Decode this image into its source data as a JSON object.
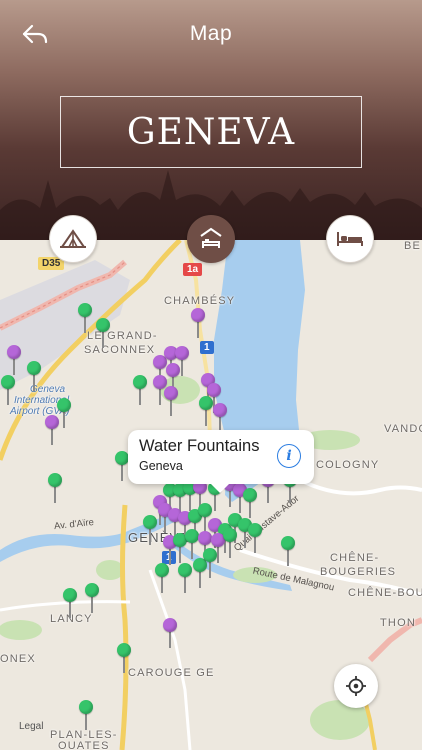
{
  "nav": {
    "title": "Map",
    "back_icon": "back-arrow-icon"
  },
  "header": {
    "city": "GENEVA"
  },
  "categories": [
    {
      "label": "attractions",
      "icon": "tent-icon",
      "active": false
    },
    {
      "label": "hotels",
      "icon": "hotel-icon",
      "active": true
    },
    {
      "label": "accommodation",
      "icon": "bed-icon",
      "active": false
    }
  ],
  "map": {
    "places": {
      "chambesy": "CHAMBÉSY",
      "grand_saconnex_1": "LE GRAND-",
      "grand_saconnex_2": "SACONNEX",
      "airport_1": "Geneva",
      "airport_2": "International",
      "airport_3": "Airport (GVA)",
      "vandoeuvres": "VANDO",
      "cologny": "COLOGNY",
      "geneva": "GENÈVE",
      "chene_bougeries_1": "CHÊNE-",
      "chene_bougeries_2": "BOUGERIES",
      "chene_bourg": "CHÊNE-BOU",
      "thonex": "THON",
      "lancy": "LANCY",
      "onex": "ONEX",
      "carouge": "CAROUGE GE",
      "plan_les_ouates_1": "PLAN-LES-",
      "plan_les_ouates_2": "OUATES",
      "bellevue": "BE"
    },
    "roads": {
      "d35": "D35",
      "r1a": "1a",
      "r1_north": "1",
      "r1_south": "1",
      "av_aire": "Av. d'Aïre",
      "malagnou": "Route de Malagnou",
      "quai": "Quai Gustave-Ador"
    },
    "pin_colors": {
      "green": "#35c46a",
      "purple": "#b566d8"
    },
    "water_color": "#a7cdee",
    "callout": {
      "title": "Water Fountains",
      "subtitle": "Geneva"
    },
    "locate_icon": "locate-crosshair-icon",
    "legal": "Legal"
  }
}
